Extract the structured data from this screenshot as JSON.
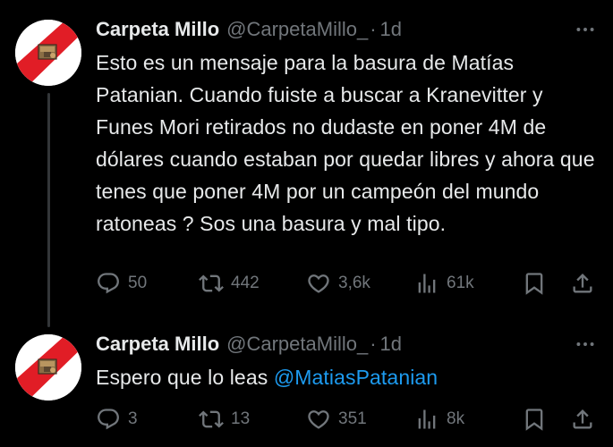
{
  "tweets": [
    {
      "author_name": "Carpeta Millo",
      "handle": "@CarpetaMillo_",
      "separator": "·",
      "time": "1d",
      "text": "Esto es un mensaje para la basura de Matías Patanian. Cuando fuiste a buscar a Kranevitter y Funes Mori retirados no dudaste en poner 4M de dólares cuando estaban por quedar libres y ahora que tenes que poner 4M por un campeón del mundo ratoneas ? Sos una basura y mal tipo.",
      "replies": "50",
      "retweets": "442",
      "likes": "3,6k",
      "views": "61k"
    },
    {
      "author_name": "Carpeta Millo",
      "handle": "@CarpetaMillo_",
      "separator": "·",
      "time": "1d",
      "text": "Espero que lo leas ",
      "mention": "@MatiasPatanian",
      "replies": "3",
      "retweets": "13",
      "likes": "351",
      "views": "8k"
    }
  ],
  "icons": {
    "reply": "reply-icon",
    "retweet": "retweet-icon",
    "like": "heart-icon",
    "views": "views-chart-icon",
    "bookmark": "bookmark-icon",
    "share": "share-icon",
    "more": "more-options-icon"
  },
  "colors": {
    "background": "#000000",
    "text": "#e7e9ea",
    "muted": "#71767b",
    "link": "#1d9bf0",
    "avatar_sash": "#e11d26"
  }
}
